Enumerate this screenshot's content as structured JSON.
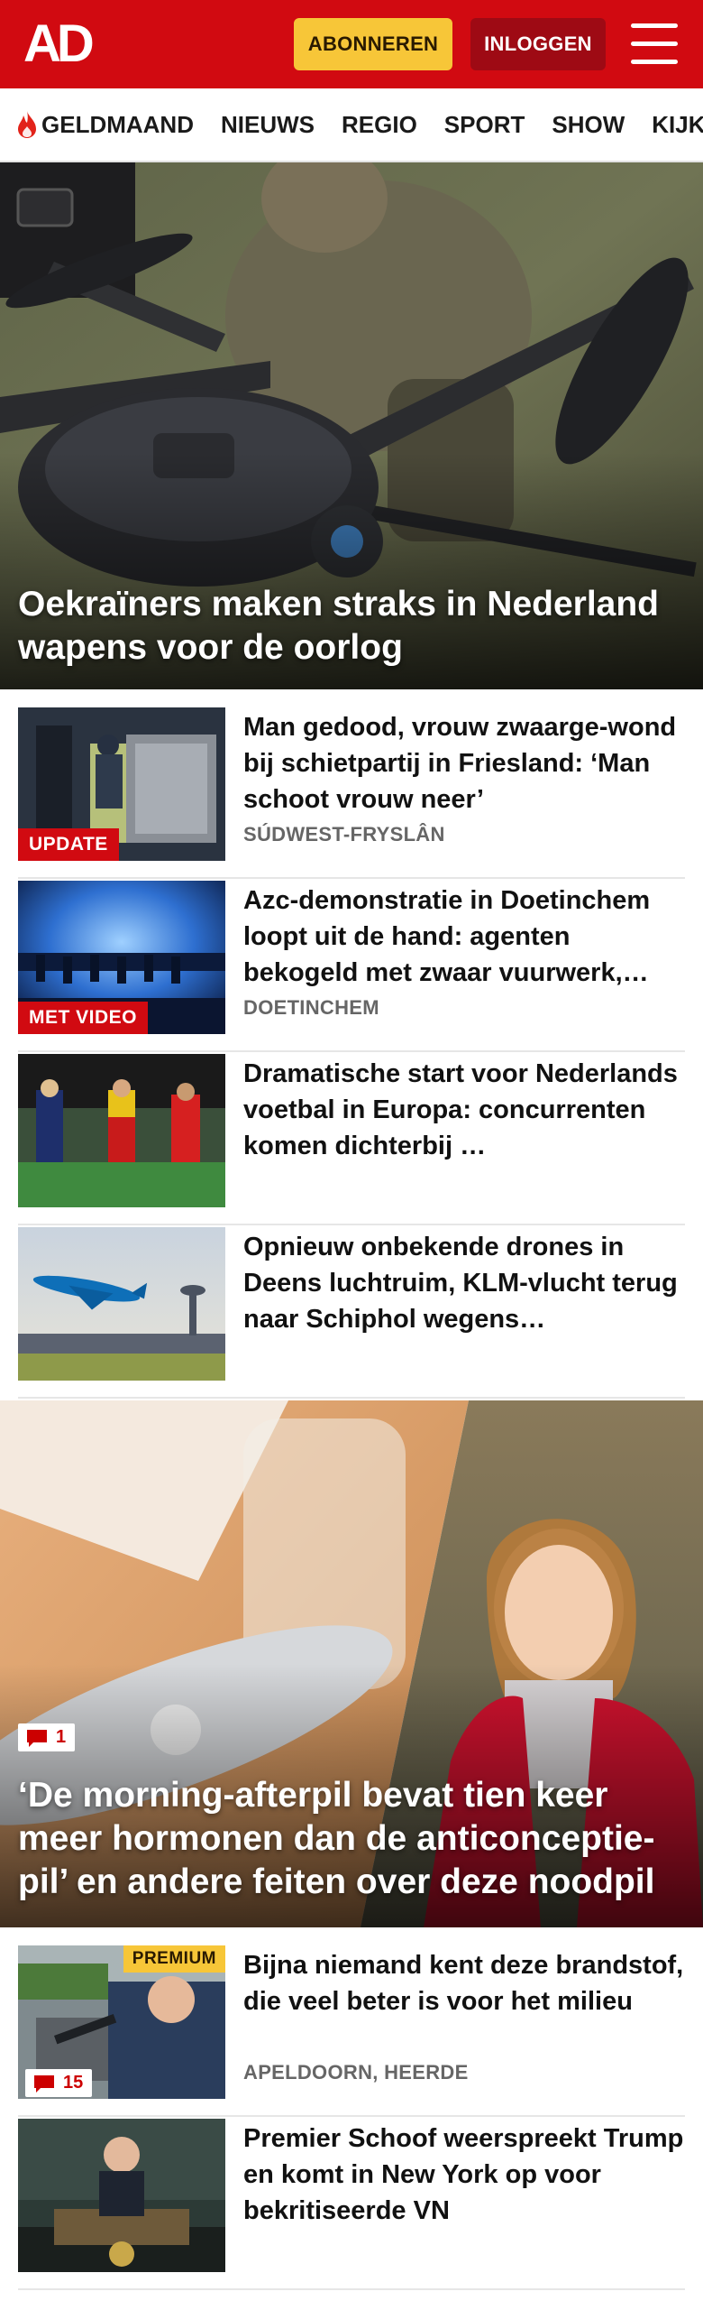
{
  "header": {
    "logo": "AD",
    "subscribe_label": "ABONNEREN",
    "login_label": "INLOGGEN",
    "brand_color": "#d10a11",
    "subscribe_color": "#f7c638"
  },
  "nav": {
    "items": [
      {
        "label": "GELDMAAND",
        "icon": "flame-icon"
      },
      {
        "label": "NIEUWS"
      },
      {
        "label": "REGIO"
      },
      {
        "label": "SPORT"
      },
      {
        "label": "SHOW"
      },
      {
        "label": "KIJK"
      }
    ]
  },
  "hero": {
    "title": "Oekraïners maken straks in Nederland wapens voor de oorlog"
  },
  "articles": [
    {
      "title": "Man gedood, vrouw zwaarge-wond bij schietpartij in Friesland: ‘Man schoot vrouw neer’",
      "location": "SÚDWEST-FRYSLÂN",
      "badge": "UPDATE"
    },
    {
      "title": "Azc-demonstratie in Doetinchem loopt uit de hand: agenten bekogeld met zwaar vuurwerk,…",
      "location": "DOETINCHEM",
      "badge": "MET VIDEO"
    },
    {
      "title": "Dramatische start voor Nederlands voetbal in Europa: concurrenten komen dichterbij …"
    },
    {
      "title": "Opnieuw onbekende drones in Deens luchtruim, KLM-vlucht terug naar Schiphol wegens…"
    }
  ],
  "feature": {
    "title": "‘De morning-afterpil bevat tien keer meer hormonen dan de anticonceptie-pil’ en andere feiten over deze noodpil",
    "comment_count": "1"
  },
  "articles2": [
    {
      "title": "Bijna niemand kent deze brandstof, die veel beter is voor het milieu",
      "location": "APELDOORN, HEERDE",
      "badge": "PREMIUM",
      "comment_count": "15"
    },
    {
      "title": "Premier Schoof weerspreekt Trump en komt in New York op voor bekritiseerde VN"
    }
  ]
}
